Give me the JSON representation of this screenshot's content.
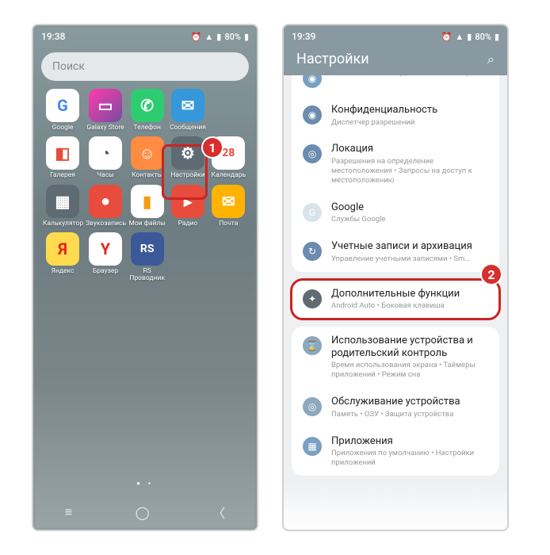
{
  "left": {
    "time": "19:38",
    "battery": "80%",
    "search_placeholder": "Поиск",
    "apps": [
      {
        "label": "Google",
        "bg": "#ffffff",
        "glyph": "G",
        "gcolor": "#4285f4"
      },
      {
        "label": "Galaxy Store",
        "bg": "linear-gradient(135deg,#ff3cac,#784ba0)",
        "glyph": "▭",
        "gcolor": "#fff"
      },
      {
        "label": "Телефон",
        "bg": "#2ecc71",
        "glyph": "✆",
        "gcolor": "#fff"
      },
      {
        "label": "Сообщения",
        "bg": "#3498db",
        "glyph": "✉",
        "gcolor": "#fff"
      },
      {
        "label": "",
        "bg": "transparent",
        "glyph": "",
        "gcolor": ""
      },
      {
        "label": "Галерея",
        "bg": "#ffffff",
        "glyph": "◧",
        "gcolor": "#e74c3c"
      },
      {
        "label": "Часы",
        "bg": "#ffffff",
        "glyph": "◔",
        "gcolor": "#555"
      },
      {
        "label": "Контакты",
        "bg": "#ff8c42",
        "glyph": "☺",
        "gcolor": "#fff"
      },
      {
        "label": "Настройки",
        "bg": "#5f6b72",
        "glyph": "⚙",
        "gcolor": "#fff"
      },
      {
        "label": "Календарь",
        "bg": "#ffffff",
        "glyph": "28",
        "gcolor": "#e74c3c"
      },
      {
        "label": "Калькулятор",
        "bg": "#5f6b72",
        "glyph": "▦",
        "gcolor": "#fff"
      },
      {
        "label": "Звукозапись",
        "bg": "#e74c3c",
        "glyph": "●",
        "gcolor": "#fff"
      },
      {
        "label": "Мои файлы",
        "bg": "#ffffff",
        "glyph": "▮",
        "gcolor": "#f39c12"
      },
      {
        "label": "Радио",
        "bg": "#e74c3c",
        "glyph": "▸",
        "gcolor": "#fff"
      },
      {
        "label": "Почта",
        "bg": "#ffb300",
        "glyph": "✉",
        "gcolor": "#fff"
      },
      {
        "label": "Яндекс",
        "bg": "#ffdb4d",
        "glyph": "Я",
        "gcolor": "#e52620"
      },
      {
        "label": "Браузер",
        "bg": "#ffffff",
        "glyph": "Y",
        "gcolor": "#e52620"
      },
      {
        "label": "RS Проводник",
        "bg": "#3b5998",
        "glyph": "RS",
        "gcolor": "#fff"
      }
    ],
    "callout": "1"
  },
  "right": {
    "time": "19:39",
    "battery": "80%",
    "header": "Настройки",
    "callout": "2",
    "groups": [
      {
        "rows": [
          {
            "icon_bg": "#7aa0c4",
            "glyph": "◉",
            "title": "",
            "sub": "Распознавание лица, отпечатки пальцев"
          },
          {
            "icon_bg": "#6b8caf",
            "glyph": "◉",
            "title": "Конфиденциальность",
            "sub": "Диспетчер разрешений"
          },
          {
            "icon_bg": "#6b8caf",
            "glyph": "◎",
            "title": "Локация",
            "sub": "Разрешения на определение местоположения • Запросы на доступ к местоположению"
          },
          {
            "icon_bg": "#d8e3ea",
            "glyph": "G",
            "title": "Google",
            "sub": "Службы Google"
          },
          {
            "icon_bg": "#6b8caf",
            "glyph": "↻",
            "title": "Учетные записи и архивация",
            "sub": "Управление учетными записями • Sm…"
          }
        ]
      },
      {
        "rows": [
          {
            "icon_bg": "#5f6b72",
            "glyph": "✦",
            "title": "Дополнительные функции",
            "sub": "Android Auto • Боковая клавиша"
          }
        ],
        "highlighted": true
      },
      {
        "rows": [
          {
            "icon_bg": "#8ca8bc",
            "glyph": "⌛",
            "title": "Использование устройства и родительский контроль",
            "sub": "Время использования экрана • Таймеры приложений • Режим сна"
          },
          {
            "icon_bg": "#8ca8bc",
            "glyph": "◎",
            "title": "Обслуживание устройства",
            "sub": "Память • ОЗУ • Защита устройства"
          },
          {
            "icon_bg": "#7aa0c4",
            "glyph": "▦",
            "title": "Приложения",
            "sub": "Приложения по умолчанию • Настройки приложений"
          }
        ]
      }
    ]
  }
}
